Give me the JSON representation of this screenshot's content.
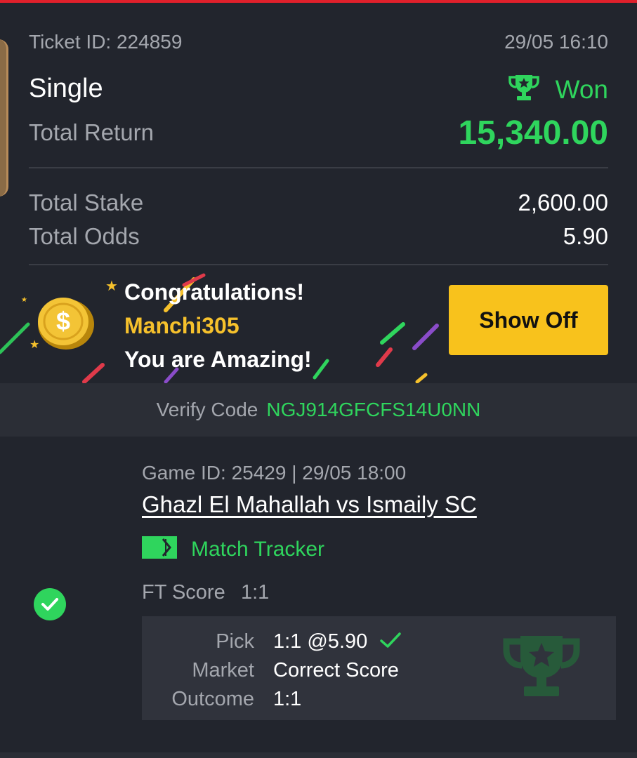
{
  "ticket": {
    "id_text": "Ticket ID: 224859",
    "date": "29/05 16:10",
    "type": "Single",
    "status": "Won",
    "total_return_label": "Total Return",
    "total_return": "15,340.00",
    "total_stake_label": "Total Stake",
    "total_stake": "2,600.00",
    "total_odds_label": "Total Odds",
    "total_odds": "5.90"
  },
  "promo": {
    "congrats": "Congratulations!",
    "username": "Manchi305",
    "message": "You are Amazing!",
    "button_label": "Show Off",
    "coin_symbol": "$"
  },
  "verify": {
    "label": "Verify Code",
    "code": "NGJ914GFCFS14U0NN"
  },
  "game": {
    "id_line": "Game ID: 25429 | 29/05 18:00",
    "match": "Ghazl El Mahallah vs Ismaily SC",
    "tracker_label": "Match Tracker",
    "ft_label": "FT Score",
    "ft_score": "1:1",
    "pick_label": "Pick",
    "pick_value": "1:1 @5.90",
    "market_label": "Market",
    "market_value": "Correct Score",
    "outcome_label": "Outcome",
    "outcome_value": "1:1"
  },
  "colors": {
    "accent_green": "#2fd55d",
    "gold": "#f6c12c",
    "button_yellow": "#f8c21c",
    "top_bar_red": "#e0202b",
    "background": "#22252d"
  },
  "icons": {
    "status": "trophy-icon",
    "coin": "dollar-coin-icon",
    "tracker": "match-tracker-icon",
    "selection": "check-circle-icon",
    "pick": "checkmark-icon",
    "watermark": "trophy-watermark-icon"
  }
}
